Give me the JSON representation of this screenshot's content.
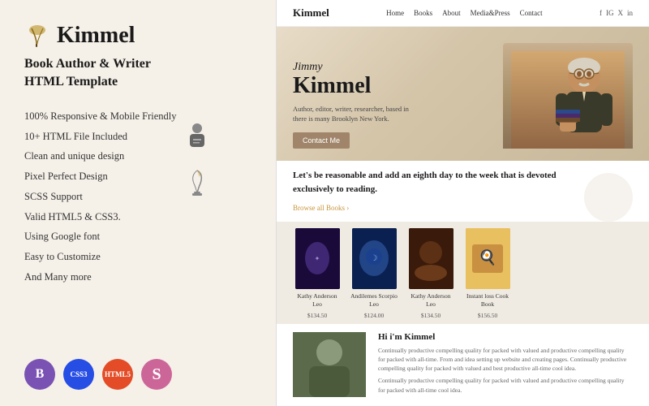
{
  "left": {
    "logo_icon": "✒",
    "logo_text": "Kimmel",
    "subtitle_line1": "Book Author & Writer",
    "subtitle_line2": "HTML Template",
    "features": [
      "100% Responsive & Mobile Friendly",
      "10+ HTML File Included",
      "Clean and unique design",
      "Pixel Perfect Design",
      "SCSS Support",
      "Valid HTML5 & CSS3.",
      "Using Google font",
      "Easy to Customize",
      "And Many more"
    ],
    "badges": [
      {
        "label": "B",
        "type": "bootstrap"
      },
      {
        "label": "CSS",
        "type": "css"
      },
      {
        "label": "HTML",
        "type": "html"
      },
      {
        "label": "S",
        "type": "sass"
      }
    ]
  },
  "site": {
    "nav": {
      "logo": "Kimmel",
      "links": [
        "Home",
        "Books",
        "About",
        "Media&Press",
        "Contact"
      ],
      "social": [
        "f",
        "IG",
        "X",
        "in"
      ]
    },
    "hero": {
      "name_small": "Jimmy",
      "name_big": "Kimmel",
      "description": "Author, editor, writer, researcher, based in\nthere is many Brooklyn New York.",
      "cta_button": "Contact Me"
    },
    "reading": {
      "heading": "Let's be reasonable and add an eighth\nday to the week that is devoted\nexclusively to reading.",
      "browse_link": "Browse all Books ›"
    },
    "books": [
      {
        "title": "Kathy Anderson Leo",
        "price": "$134.50",
        "cover_type": "1"
      },
      {
        "title": "Andilemes Scorpio Leo",
        "price": "$124.00",
        "cover_type": "2"
      },
      {
        "title": "Kathy Anderson Leo",
        "price": "$134.50",
        "cover_type": "3"
      },
      {
        "title": "Instant loss Cook Book",
        "price": "$156.50",
        "cover_type": "4"
      }
    ],
    "about": {
      "title": "Hi i'm Kimmel",
      "desc_line1": "Continually productive compelling quality for packed with valued and productive compelling quality for packed with all-time. From and idea setting up website and creating pages. Continually productive compelling quality for packed with valued and best productive all-time cool idea.",
      "desc_line2": "Continually productive compelling quality for packed with valued and productive compelling quality for packed with all-time cool idea."
    }
  }
}
